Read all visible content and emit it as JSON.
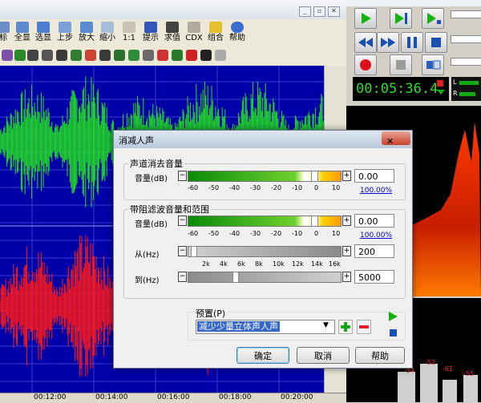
{
  "toolbar": {
    "items": [
      "标",
      "全显",
      "选显",
      "上步",
      "放大",
      "缩小",
      "1:1",
      "提示",
      "求值",
      "CDX",
      "组合",
      "帮助"
    ]
  },
  "timeline": {
    "ticks": [
      "00:12:00",
      "00:14:00",
      "00:16:00",
      "00:18:00",
      "00:20:00"
    ]
  },
  "transport": {
    "time_display": "00:05:36.4",
    "meter_l": "L",
    "meter_r": "R"
  },
  "level_bars": {
    "labels": [
      "-54",
      "-52",
      "-61",
      "-55"
    ]
  },
  "dialog": {
    "title": "消减人声",
    "close": "✕",
    "group1": {
      "title": "声道消去音量",
      "label": "音量(dB)",
      "minus": "−",
      "plus": "+",
      "scale": [
        "-60",
        "-50",
        "-40",
        "-30",
        "-20",
        "-10",
        "0",
        "10"
      ],
      "value": "0.00",
      "percent": "100.00%"
    },
    "group2": {
      "title": "带阻滤波音量和范围",
      "volume": {
        "label": "音量(dB)",
        "minus": "−",
        "plus": "+",
        "scale": [
          "-60",
          "-50",
          "-40",
          "-30",
          "-20",
          "-10",
          "0",
          "10"
        ],
        "value": "0.00",
        "percent": "100.00%"
      },
      "from": {
        "label": "从(Hz)",
        "minus": "−",
        "plus": "+",
        "scale": [
          "2k",
          "4k",
          "6k",
          "8k",
          "10k",
          "12k",
          "14k",
          "16k"
        ],
        "value": "200"
      },
      "to": {
        "label": "到(Hz)",
        "minus": "−",
        "plus": "+",
        "scale": [
          "2k",
          "4k",
          "6k",
          "8k",
          "10k",
          "12k",
          "14k",
          "16k"
        ],
        "value": "5000"
      }
    },
    "preset": {
      "label": "预置(P)",
      "value": "减少少量立体声人声"
    },
    "buttons": {
      "ok": "确定",
      "cancel": "取消",
      "help": "帮助"
    }
  }
}
